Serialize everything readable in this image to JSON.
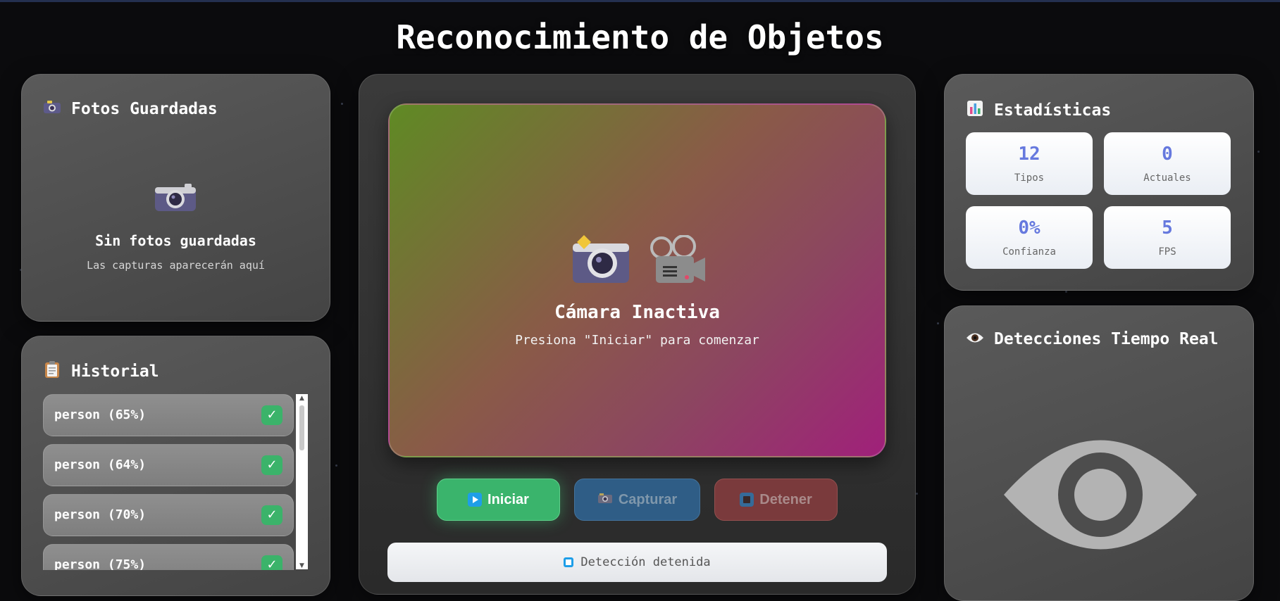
{
  "page_title": "Reconocimiento de Objetos",
  "photos_panel": {
    "icon": "camera-icon",
    "title": "Fotos Guardadas",
    "empty_title": "Sin fotos guardadas",
    "empty_subtitle": "Las capturas aparecerán aquí"
  },
  "history_panel": {
    "icon": "clipboard-icon",
    "title": "Historial",
    "items": [
      {
        "label": "person (65%)",
        "status": "✓"
      },
      {
        "label": "person (64%)",
        "status": "✓"
      },
      {
        "label": "person (70%)",
        "status": "✓"
      },
      {
        "label": "person (75%)",
        "status": "✓"
      }
    ]
  },
  "camera": {
    "icons": [
      "camera-flash-icon",
      "movie-camera-icon"
    ],
    "title": "Cámara Inactiva",
    "subtitle": "Presiona \"Iniciar\" para comenzar"
  },
  "controls": {
    "start_label": "Iniciar",
    "capture_label": "Capturar",
    "stop_label": "Detener"
  },
  "status_bar": {
    "text": "Detección detenida"
  },
  "stats_panel": {
    "icon": "bar-chart-icon",
    "title": "Estadísticas",
    "items": [
      {
        "value": "12",
        "label": "Tipos"
      },
      {
        "value": "0",
        "label": "Actuales"
      },
      {
        "value": "0%",
        "label": "Confianza"
      },
      {
        "value": "5",
        "label": "FPS"
      }
    ]
  },
  "detections_panel": {
    "icon": "eye-icon",
    "title": "Detecciones Tiempo Real"
  },
  "colors": {
    "background": "#0b0b0d",
    "accent_green": "#3ab46c",
    "accent_blue": "#2f5d86",
    "accent_red": "#7a3a3c",
    "stat_value": "#6679de"
  }
}
